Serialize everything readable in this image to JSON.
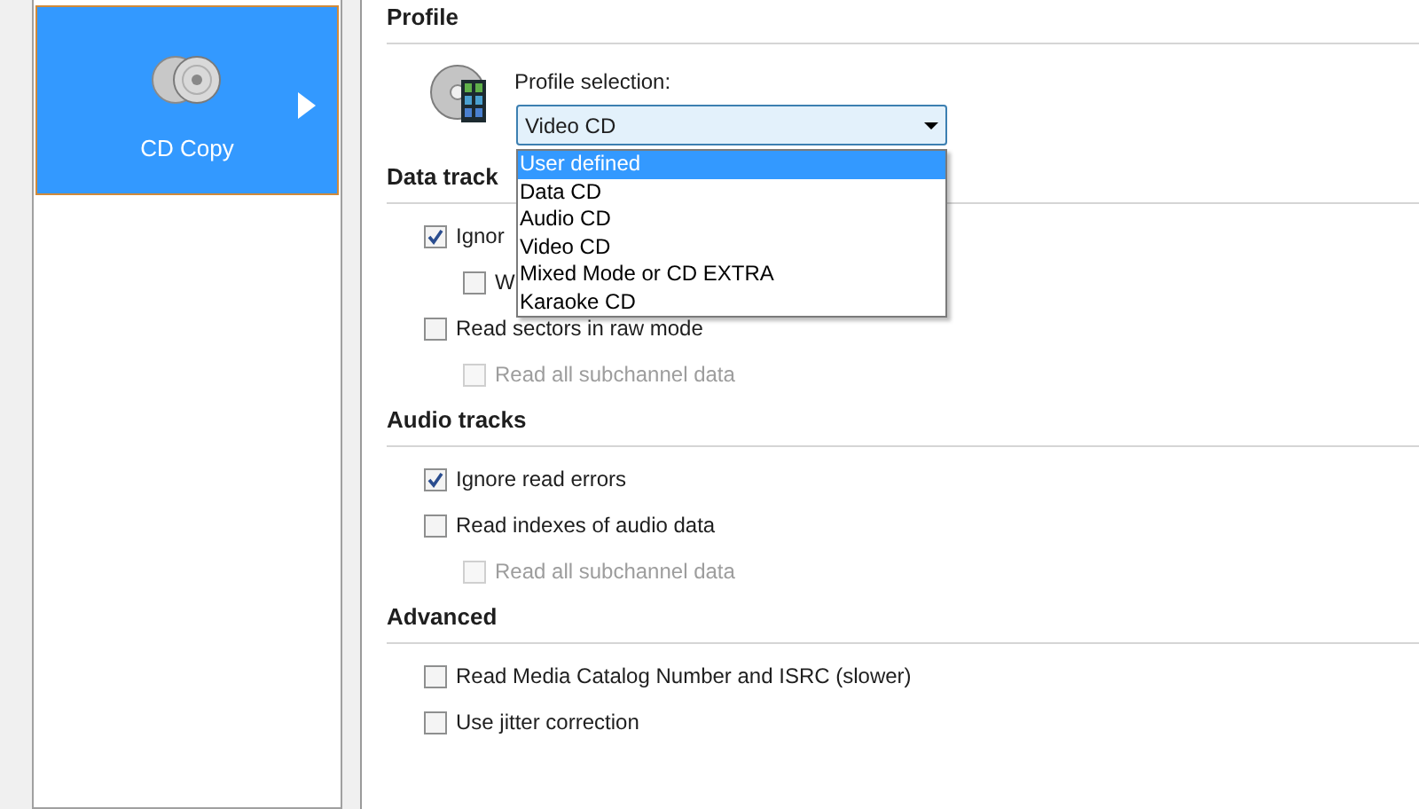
{
  "sidebar": {
    "items": [
      {
        "label": "CD Copy",
        "selected": true
      }
    ]
  },
  "profile": {
    "title": "Profile",
    "selection_label": "Profile selection:",
    "dropdown": {
      "value": "Video CD",
      "expanded": true,
      "options": [
        {
          "label": "User defined",
          "highlighted": true
        },
        {
          "label": "Data CD",
          "highlighted": false
        },
        {
          "label": "Audio CD",
          "highlighted": false
        },
        {
          "label": "Video CD",
          "highlighted": false
        },
        {
          "label": "Mixed Mode or CD EXTRA",
          "highlighted": false
        },
        {
          "label": "Karaoke CD",
          "highlighted": false
        }
      ]
    }
  },
  "sections": [
    {
      "title": "Data track",
      "items": [
        {
          "label": "Ignor",
          "checked": true,
          "disabled": false,
          "children": [
            {
              "label": "W",
              "checked": false,
              "disabled": false
            }
          ]
        },
        {
          "label": "Read sectors in raw mode",
          "checked": false,
          "disabled": false,
          "children": [
            {
              "label": "Read all subchannel data",
              "checked": false,
              "disabled": true
            }
          ]
        }
      ]
    },
    {
      "title": "Audio tracks",
      "items": [
        {
          "label": "Ignore read errors",
          "checked": true,
          "disabled": false
        },
        {
          "label": "Read indexes of audio data",
          "checked": false,
          "disabled": false,
          "children": [
            {
              "label": "Read all subchannel data",
              "checked": false,
              "disabled": true
            }
          ]
        }
      ]
    },
    {
      "title": "Advanced",
      "items": [
        {
          "label": "Read Media Catalog Number and ISRC (slower)",
          "checked": false,
          "disabled": false
        },
        {
          "label": "Use jitter correction",
          "checked": false,
          "disabled": false
        }
      ]
    }
  ]
}
